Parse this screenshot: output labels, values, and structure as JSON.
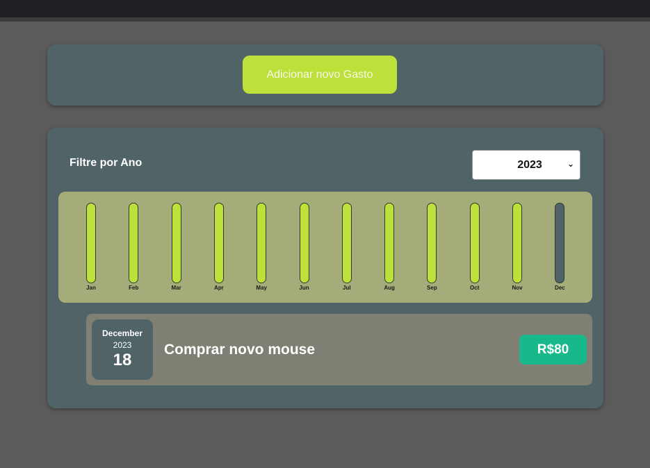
{
  "header": {
    "add_button_label": "Adicionar novo Gasto"
  },
  "filter": {
    "label": "Filtre por Ano",
    "selected_year": "2023"
  },
  "colors": {
    "accent": "#bde03a",
    "card": "#506367",
    "chart_bg": "#a4ad7a",
    "price_badge": "#17b98a"
  },
  "chart_data": {
    "type": "bar",
    "categories": [
      "Jan",
      "Feb",
      "Mar",
      "Apr",
      "May",
      "Jun",
      "Jul",
      "Aug",
      "Sep",
      "Oct",
      "Nov",
      "Dec"
    ],
    "fill_fraction": [
      1,
      1,
      1,
      1,
      1,
      1,
      1,
      1,
      1,
      1,
      1,
      0
    ],
    "title": "",
    "xlabel": "",
    "ylabel": ""
  },
  "expenses": [
    {
      "month": "December",
      "year": "2023",
      "day": "18",
      "title": "Comprar novo mouse",
      "amount": "R$80"
    }
  ]
}
